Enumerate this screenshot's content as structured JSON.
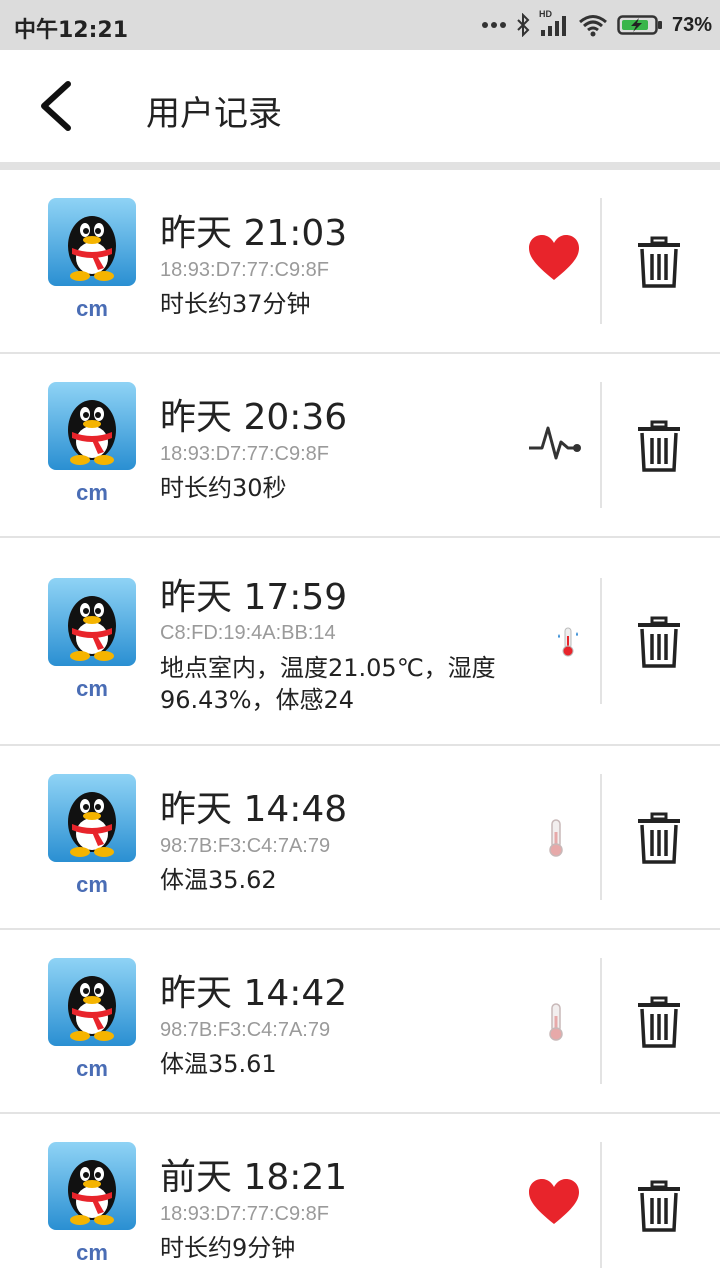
{
  "status_bar": {
    "time": "中午12:21",
    "network_label": "HD",
    "battery": "73%"
  },
  "header": {
    "title": "用户记录"
  },
  "records": [
    {
      "user": "cm",
      "time": "昨天 21:03",
      "mac": "18:93:D7:77:C9:8F",
      "desc": "时长约37分钟",
      "icon": "heart-icon"
    },
    {
      "user": "cm",
      "time": "昨天 20:36",
      "mac": "18:93:D7:77:C9:8F",
      "desc": "时长约30秒",
      "icon": "pulse-icon"
    },
    {
      "user": "cm",
      "time": "昨天 17:59",
      "mac": "C8:FD:19:4A:BB:14",
      "desc": "地点室内，温度21.05℃，湿度96.43%，体感24",
      "icon": "humidity-thermometer-icon"
    },
    {
      "user": "cm",
      "time": "昨天 14:48",
      "mac": "98:7B:F3:C4:7A:79",
      "desc": "体温35.62",
      "icon": "thermometer-icon"
    },
    {
      "user": "cm",
      "time": "昨天 14:42",
      "mac": "98:7B:F3:C4:7A:79",
      "desc": "体温35.61",
      "icon": "thermometer-icon"
    },
    {
      "user": "cm",
      "time": "前天 18:21",
      "mac": "18:93:D7:77:C9:8F",
      "desc": "时长约9分钟",
      "icon": "heart-icon"
    }
  ],
  "colors": {
    "status_bar": "#dcdcdc",
    "username": "#4a6db5",
    "heart": "#e8242b",
    "divider": "#e3e3e3",
    "mac_text": "#9a9a9a"
  }
}
